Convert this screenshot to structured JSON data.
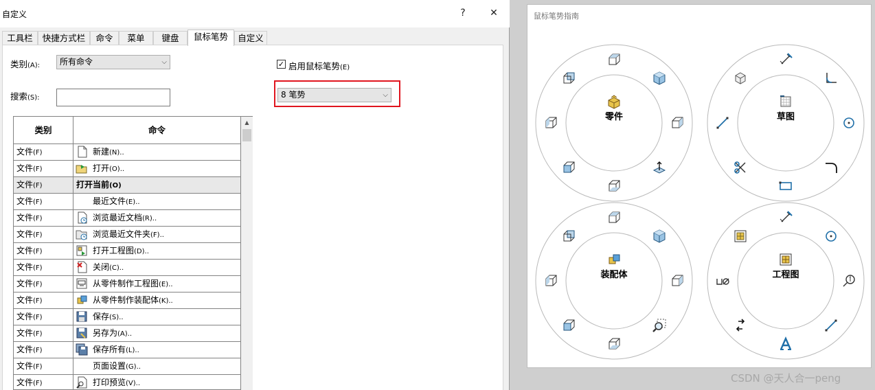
{
  "dialog": {
    "title": "自定义",
    "help_label": "?",
    "close_label": "✕",
    "tabs": [
      "工具栏",
      "快捷方式栏",
      "命令",
      "菜单",
      "键盘",
      "鼠标笔势",
      "自定义"
    ],
    "category_label": "类别",
    "category_accel": "(A):",
    "category_value": "所有命令",
    "search_label": "搜索",
    "search_accel": "(S):",
    "search_value": "",
    "enable_checked": "✓",
    "enable_label": "启用鼠标笔势",
    "enable_accel": "(E)",
    "gesture_value": "8 笔势",
    "dropdown_arrow": "⌵",
    "table": {
      "col_category": "类别",
      "col_command": "命令",
      "rows": [
        {
          "cat": "文件",
          "acc": "(F)",
          "cmd": "新建",
          "key": "(N)..",
          "icon": "new-document-icon"
        },
        {
          "cat": "文件",
          "acc": "(F)",
          "cmd": "打开",
          "key": "(O)..",
          "icon": "open-folder-icon"
        },
        {
          "cat": "文件",
          "acc": "(F)",
          "cmd": "打开当前",
          "key": "(O)",
          "icon": ""
        },
        {
          "cat": "文件",
          "acc": "(F)",
          "cmd": "最近文件",
          "key": "(E)..",
          "icon": ""
        },
        {
          "cat": "文件",
          "acc": "(F)",
          "cmd": "浏览最近文档",
          "key": "(R)..",
          "icon": "recent-document-icon"
        },
        {
          "cat": "文件",
          "acc": "(F)",
          "cmd": "浏览最近文件夹",
          "key": "(F)..",
          "icon": "recent-folder-icon"
        },
        {
          "cat": "文件",
          "acc": "(F)",
          "cmd": "打开工程图",
          "key": "(D)..",
          "icon": "open-drawing-icon"
        },
        {
          "cat": "文件",
          "acc": "(F)",
          "cmd": "关闭",
          "key": "(C)..",
          "icon": "close-file-icon"
        },
        {
          "cat": "文件",
          "acc": "(F)",
          "cmd": "从零件制作工程图",
          "key": "(E)..",
          "icon": "make-drawing-icon"
        },
        {
          "cat": "文件",
          "acc": "(F)",
          "cmd": "从零件制作装配体",
          "key": "(K)..",
          "icon": "make-assembly-icon"
        },
        {
          "cat": "文件",
          "acc": "(F)",
          "cmd": "保存",
          "key": "(S)..",
          "icon": "save-icon"
        },
        {
          "cat": "文件",
          "acc": "(F)",
          "cmd": "另存为",
          "key": "(A)..",
          "icon": "save-as-icon"
        },
        {
          "cat": "文件",
          "acc": "(F)",
          "cmd": "保存所有",
          "key": "(L)..",
          "icon": "save-all-icon"
        },
        {
          "cat": "文件",
          "acc": "(F)",
          "cmd": "页面设置",
          "key": "(G)..",
          "icon": ""
        },
        {
          "cat": "文件",
          "acc": "(F)",
          "cmd": "打印预览",
          "key": "(V)..",
          "icon": "print-preview-icon"
        }
      ]
    }
  },
  "guide": {
    "title": "鼠标笔势指南",
    "rings": [
      {
        "label": "零件",
        "icons": [
          "top-view-icon",
          "isometric-view-icon",
          "right-view-icon",
          "normal-to-icon",
          "bottom-view-icon",
          "front-view-icon",
          "left-view-icon",
          "back-view-icon"
        ]
      },
      {
        "label": "草图",
        "icons": [
          "smart-dimension-icon",
          "fillet-sketch-icon",
          "circle-icon",
          "fillet-arc-icon",
          "rectangle-icon",
          "trim-icon",
          "line-icon",
          "view-3d-icon"
        ]
      },
      {
        "label": "装配体",
        "icons": [
          "top-view-icon",
          "isometric-view-icon",
          "right-view-icon",
          "zoom-select-icon",
          "bottom-view-icon",
          "front-view-icon",
          "left-view-icon",
          "back-view-icon"
        ]
      },
      {
        "label": "工程图",
        "icons": [
          "smart-dimension-icon",
          "circle-icon",
          "balloon-icon",
          "line-icon",
          "text-icon",
          "rotate-view-icon",
          "hole-callout-icon",
          "model-view-icon"
        ]
      }
    ],
    "accent": "#1f6fa8"
  },
  "watermark": "CSDN @天人合一peng"
}
